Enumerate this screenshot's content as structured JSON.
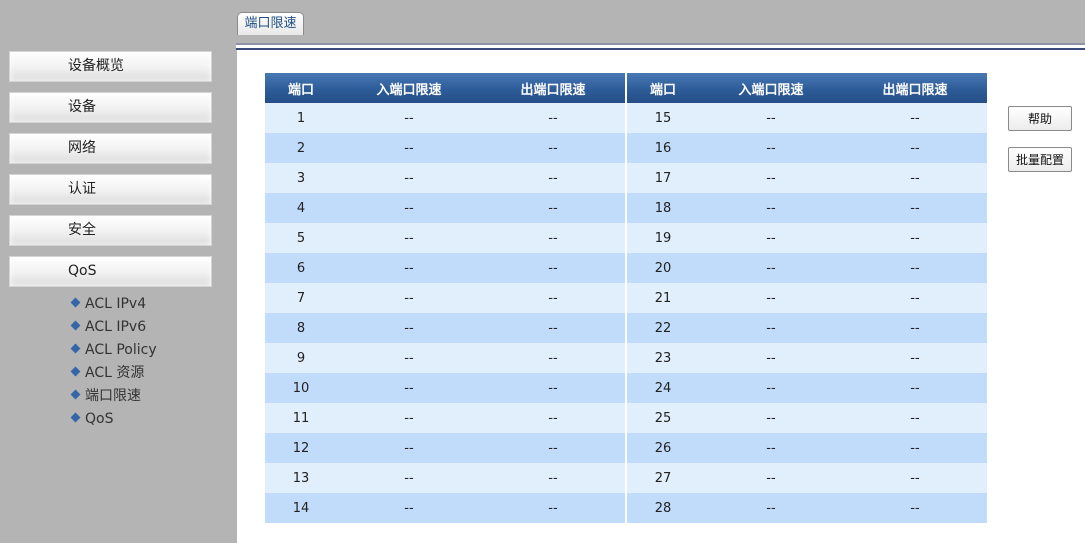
{
  "sidebar": {
    "items": [
      "设备概览",
      "设备",
      "网络",
      "认证",
      "安全",
      "QoS"
    ],
    "sub_items": [
      "ACL IPv4",
      "ACL IPv6",
      "ACL Policy",
      "ACL 资源",
      "端口限速",
      "QoS"
    ]
  },
  "tabs": {
    "active_label": "端口限速"
  },
  "table": {
    "headers": {
      "port": "端口",
      "ingress": "入端口限速",
      "egress": "出端口限速"
    },
    "rows_left": [
      {
        "port": "1",
        "ingress": "--",
        "egress": "--"
      },
      {
        "port": "2",
        "ingress": "--",
        "egress": "--"
      },
      {
        "port": "3",
        "ingress": "--",
        "egress": "--"
      },
      {
        "port": "4",
        "ingress": "--",
        "egress": "--"
      },
      {
        "port": "5",
        "ingress": "--",
        "egress": "--"
      },
      {
        "port": "6",
        "ingress": "--",
        "egress": "--"
      },
      {
        "port": "7",
        "ingress": "--",
        "egress": "--"
      },
      {
        "port": "8",
        "ingress": "--",
        "egress": "--"
      },
      {
        "port": "9",
        "ingress": "--",
        "egress": "--"
      },
      {
        "port": "10",
        "ingress": "--",
        "egress": "--"
      },
      {
        "port": "11",
        "ingress": "--",
        "egress": "--"
      },
      {
        "port": "12",
        "ingress": "--",
        "egress": "--"
      },
      {
        "port": "13",
        "ingress": "--",
        "egress": "--"
      },
      {
        "port": "14",
        "ingress": "--",
        "egress": "--"
      }
    ],
    "rows_right": [
      {
        "port": "15",
        "ingress": "--",
        "egress": "--"
      },
      {
        "port": "16",
        "ingress": "--",
        "egress": "--"
      },
      {
        "port": "17",
        "ingress": "--",
        "egress": "--"
      },
      {
        "port": "18",
        "ingress": "--",
        "egress": "--"
      },
      {
        "port": "19",
        "ingress": "--",
        "egress": "--"
      },
      {
        "port": "20",
        "ingress": "--",
        "egress": "--"
      },
      {
        "port": "21",
        "ingress": "--",
        "egress": "--"
      },
      {
        "port": "22",
        "ingress": "--",
        "egress": "--"
      },
      {
        "port": "23",
        "ingress": "--",
        "egress": "--"
      },
      {
        "port": "24",
        "ingress": "--",
        "egress": "--"
      },
      {
        "port": "25",
        "ingress": "--",
        "egress": "--"
      },
      {
        "port": "26",
        "ingress": "--",
        "egress": "--"
      },
      {
        "port": "27",
        "ingress": "--",
        "egress": "--"
      },
      {
        "port": "28",
        "ingress": "--",
        "egress": "--"
      }
    ]
  },
  "buttons": {
    "help": "帮助",
    "batch_config": "批量配置"
  },
  "colors": {
    "header_blue": "#2d5c98",
    "row_light": "#e1eefc",
    "row_dark": "#c1dcfb",
    "bullet_blue": "#3466a8",
    "tab_text": "#1f4f86"
  }
}
